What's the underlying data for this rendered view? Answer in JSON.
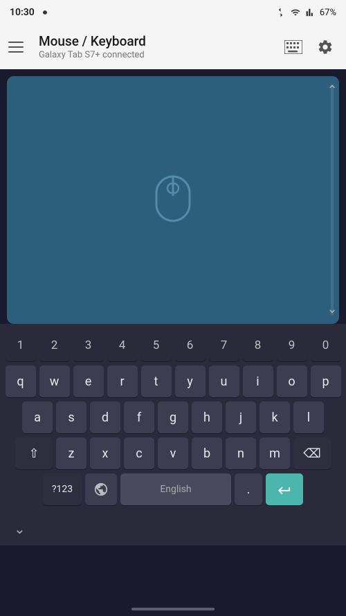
{
  "statusBar": {
    "time": "10:30",
    "battery": "67%"
  },
  "header": {
    "title": "Mouse / Keyboard",
    "subtitle": "Galaxy Tab S7+ connected",
    "menuLabel": "menu"
  },
  "touchpad": {
    "mouseIconLabel": "mouse-cursor-area"
  },
  "keyboard": {
    "row0": [
      "1",
      "2",
      "3",
      "4",
      "5",
      "6",
      "7",
      "8",
      "9",
      "0"
    ],
    "row1": [
      "q",
      "w",
      "e",
      "r",
      "t",
      "y",
      "u",
      "i",
      "o",
      "p"
    ],
    "row2": [
      "a",
      "s",
      "d",
      "f",
      "g",
      "h",
      "j",
      "k",
      "l"
    ],
    "row3": [
      "z",
      "x",
      "c",
      "v",
      "b",
      "n",
      "m"
    ],
    "bottomLeft": "?123",
    "comma": ",",
    "language": "English",
    "period": ".",
    "enterArrow": "⏎"
  }
}
